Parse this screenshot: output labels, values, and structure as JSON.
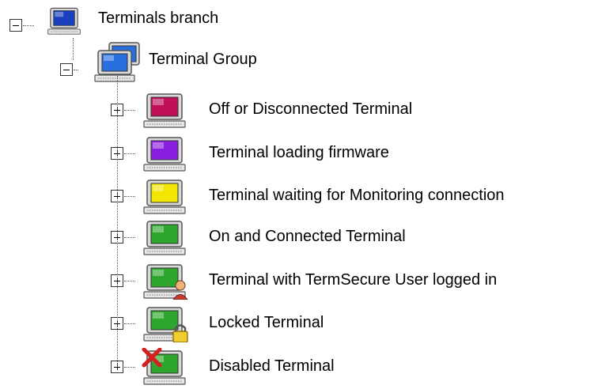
{
  "tree": {
    "root": {
      "label": "Terminals branch",
      "expanded": true,
      "icon": "terminal-blue-icon",
      "screen_color": "#1a3fbf"
    },
    "group": {
      "label": "Terminal Group",
      "expanded": true,
      "icon": "terminal-group-icon",
      "screen_color": "#2a6fe0"
    },
    "items": [
      {
        "label": "Off or Disconnected Terminal",
        "icon": "terminal-off-icon",
        "screen_color": "#c0105a",
        "badge": ""
      },
      {
        "label": "Terminal loading firmware",
        "icon": "terminal-loading-firmware-icon",
        "screen_color": "#8a1fe0",
        "badge": ""
      },
      {
        "label": "Terminal waiting for Monitoring connection",
        "icon": "terminal-waiting-icon",
        "screen_color": "#f2e600",
        "badge": ""
      },
      {
        "label": "On and Connected Terminal",
        "icon": "terminal-connected-icon",
        "screen_color": "#2ea62e",
        "badge": ""
      },
      {
        "label": "Terminal with TermSecure User logged in",
        "icon": "terminal-user-logged-in-icon",
        "screen_color": "#2ea62e",
        "badge": "user"
      },
      {
        "label": "Locked Terminal",
        "icon": "terminal-locked-icon",
        "screen_color": "#2ea62e",
        "badge": "lock"
      },
      {
        "label": "Disabled Terminal",
        "icon": "terminal-disabled-icon",
        "screen_color": "#2ea62e",
        "badge": "x"
      }
    ]
  }
}
